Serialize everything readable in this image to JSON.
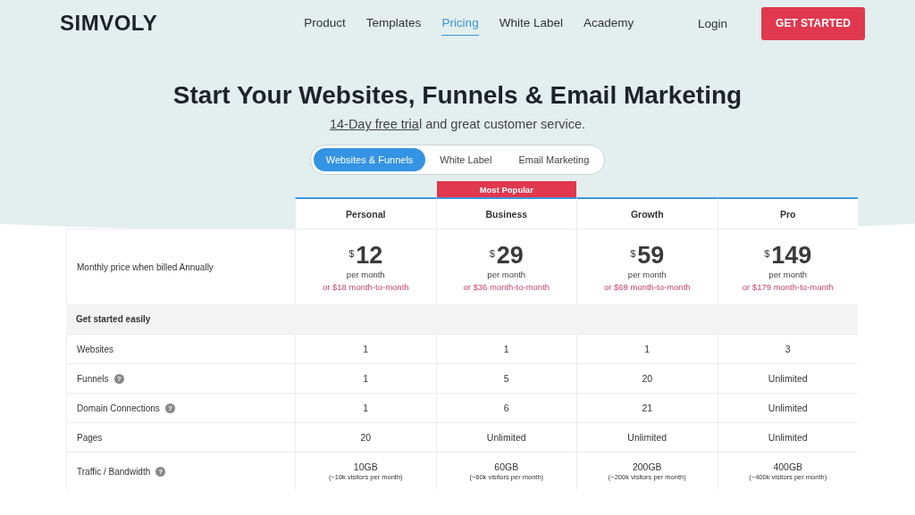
{
  "logo": "SIMVOLY",
  "nav": [
    {
      "label": "Product",
      "selected": false
    },
    {
      "label": "Templates",
      "selected": false
    },
    {
      "label": "Pricing",
      "selected": true
    },
    {
      "label": "White Label",
      "selected": false
    },
    {
      "label": "Academy",
      "selected": false
    }
  ],
  "login": "Login",
  "cta": "GET STARTED",
  "title": "Start Your Websites, Funnels & Email Marketing",
  "subtitle": {
    "link": "14-Day free tria",
    "rest": "l and great customer service."
  },
  "tabs": [
    {
      "label": "Websites & Funnels",
      "selected": true
    },
    {
      "label": "White Label",
      "selected": false
    },
    {
      "label": "Email Marketing",
      "selected": false
    }
  ],
  "badge": "Most Popular",
  "plans": [
    {
      "name": "Personal",
      "currency": "$",
      "price": "12",
      "period": "per month",
      "alt": "or $18 month-to-month",
      "popular": false
    },
    {
      "name": "Business",
      "currency": "$",
      "price": "29",
      "period": "per month",
      "alt": "or $36 month-to-month",
      "popular": true
    },
    {
      "name": "Growth",
      "currency": "$",
      "price": "59",
      "period": "per month",
      "alt": "or $69 month-to-month",
      "popular": false
    },
    {
      "name": "Pro",
      "currency": "$",
      "price": "149",
      "period": "per month",
      "alt": "or $179 month-to-month",
      "popular": false
    }
  ],
  "price_label": "Monthly price when billed Annually",
  "section": "Get started easily",
  "features": [
    {
      "label": "Websites",
      "values": [
        "1",
        "1",
        "1",
        "3"
      ]
    },
    {
      "label": "Funnels",
      "help": "?",
      "values": [
        "1",
        "5",
        "20",
        "Unlimited"
      ]
    },
    {
      "label": "Domain Connections",
      "help": "?",
      "values": [
        "1",
        "6",
        "21",
        "Unlimited"
      ]
    },
    {
      "label": "Pages",
      "values": [
        "20",
        "Unlimited",
        "Unlimited",
        "Unlimited"
      ]
    },
    {
      "label": "Traffic / Bandwidth",
      "help": "?",
      "values": [
        "10GB",
        "60GB",
        "200GB",
        "400GB"
      ],
      "notes": [
        "(~10k visitors per month)",
        "(~60k visitors per month)",
        "(~200k visitors per month)",
        "(~400k visitors per month)"
      ]
    }
  ]
}
